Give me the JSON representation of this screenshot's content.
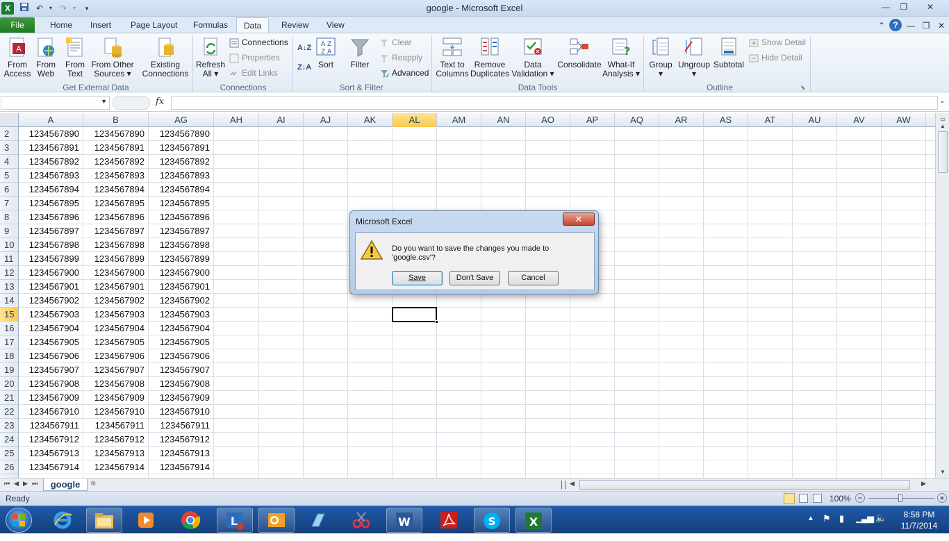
{
  "window": {
    "title": "google  -  Microsoft Excel",
    "minimize": "—",
    "restore": "❐",
    "close": "✕"
  },
  "ribbon_tabs": [
    "File",
    "Home",
    "Insert",
    "Page Layout",
    "Formulas",
    "Data",
    "Review",
    "View"
  ],
  "active_tab": "Data",
  "ribbon": {
    "get_external_data": {
      "label": "Get External Data",
      "from_access": [
        "From",
        "Access"
      ],
      "from_web": [
        "From",
        "Web"
      ],
      "from_text": [
        "From",
        "Text"
      ],
      "from_other": [
        "From Other",
        "Sources ▾"
      ],
      "existing": [
        "Existing",
        "Connections"
      ]
    },
    "connections": {
      "label": "Connections",
      "refresh": [
        "Refresh",
        "All ▾"
      ],
      "connections": "Connections",
      "properties": "Properties",
      "edit_links": "Edit Links"
    },
    "sort_filter": {
      "label": "Sort & Filter",
      "sort": "Sort",
      "filter": "Filter",
      "clear": "Clear",
      "reapply": "Reapply",
      "advanced": "Advanced"
    },
    "data_tools": {
      "label": "Data Tools",
      "text_to_columns": [
        "Text to",
        "Columns"
      ],
      "remove_duplicates": [
        "Remove",
        "Duplicates"
      ],
      "data_validation": [
        "Data",
        "Validation ▾"
      ],
      "consolidate": "Consolidate",
      "what_if": [
        "What-If",
        "Analysis ▾"
      ]
    },
    "outline": {
      "label": "Outline",
      "group": [
        "Group",
        "▾"
      ],
      "ungroup": [
        "Ungroup",
        "▾"
      ],
      "subtotal": "Subtotal",
      "show_detail": "Show Detail",
      "hide_detail": "Hide Detail"
    }
  },
  "formula_bar": {
    "name_box": "",
    "fx": "fx",
    "formula": ""
  },
  "columns": [
    "A",
    "B",
    "AG",
    "AH",
    "AI",
    "AJ",
    "AK",
    "AL",
    "AM",
    "AN",
    "AO",
    "AP",
    "AQ",
    "AR",
    "AS",
    "AT",
    "AU",
    "AV",
    "AW"
  ],
  "selected_column": "AL",
  "rows": [
    {
      "n": "2",
      "v": "1234567890"
    },
    {
      "n": "3",
      "v": "1234567891"
    },
    {
      "n": "4",
      "v": "1234567892"
    },
    {
      "n": "5",
      "v": "1234567893"
    },
    {
      "n": "6",
      "v": "1234567894"
    },
    {
      "n": "7",
      "v": "1234567895"
    },
    {
      "n": "8",
      "v": "1234567896"
    },
    {
      "n": "9",
      "v": "1234567897"
    },
    {
      "n": "10",
      "v": "1234567898"
    },
    {
      "n": "11",
      "v": "1234567899"
    },
    {
      "n": "12",
      "v": "1234567900"
    },
    {
      "n": "13",
      "v": "1234567901"
    },
    {
      "n": "14",
      "v": "1234567902"
    },
    {
      "n": "15",
      "v": "1234567903"
    },
    {
      "n": "16",
      "v": "1234567904"
    },
    {
      "n": "17",
      "v": "1234567905"
    },
    {
      "n": "18",
      "v": "1234567906"
    },
    {
      "n": "19",
      "v": "1234567907"
    },
    {
      "n": "20",
      "v": "1234567908"
    },
    {
      "n": "21",
      "v": "1234567909"
    },
    {
      "n": "22",
      "v": "1234567910"
    },
    {
      "n": "23",
      "v": "1234567911"
    },
    {
      "n": "24",
      "v": "1234567912"
    },
    {
      "n": "25",
      "v": "1234567913"
    },
    {
      "n": "26",
      "v": "1234567914"
    }
  ],
  "selected_row": "15",
  "sheet_tab": "google",
  "status": {
    "ready": "Ready",
    "zoom": "100%"
  },
  "dialog": {
    "title": "Microsoft Excel",
    "message": "Do you want to save the changes you made to 'google.csv'?",
    "save": "Save",
    "dont_save": "Don't Save",
    "cancel": "Cancel",
    "icon": "warning-icon"
  },
  "taskbar": {
    "time": "8:58 PM",
    "date": "11/7/2014",
    "apps": [
      "start-orb",
      "internet-explorer",
      "file-explorer",
      "media-player",
      "chrome",
      "lync",
      "outlook",
      "notepad",
      "snipping-tool",
      "word",
      "acrobat",
      "skype",
      "excel"
    ]
  },
  "colors": {
    "file_tab": "#2a8a2a",
    "selected_header": "#f9c94c",
    "taskbar": "#1a4d94",
    "dialog_frame": "#b3cbea"
  }
}
